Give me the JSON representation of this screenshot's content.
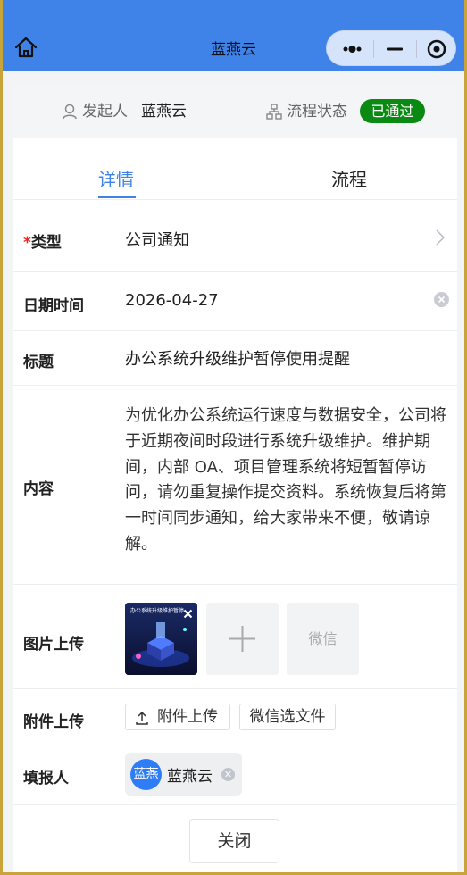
{
  "header": {
    "title": "蓝燕云",
    "home_icon": "home-icon",
    "capsule": {
      "more_icon": "more-dots-icon",
      "minimize_icon": "minimize-icon",
      "close_icon": "target-close-icon"
    }
  },
  "info": {
    "initiator_label": "发起人",
    "initiator_value": "蓝燕云",
    "status_label": "流程状态",
    "status_value": "已通过",
    "status_color": "#0b8a13"
  },
  "tabs": [
    {
      "label": "详情",
      "active": true
    },
    {
      "label": "流程",
      "active": false
    }
  ],
  "form": {
    "type": {
      "required_mark": "*",
      "label": "类型",
      "value": "公司通知"
    },
    "datetime": {
      "label": "日期时间",
      "value": "2026-04-27"
    },
    "title": {
      "label": "标题",
      "value": "办公系统升级维护暂停使用提醒"
    },
    "content": {
      "label": "内容",
      "value": "为优化办公系统运行速度与数据安全，公司将于近期夜间时段进行系统升级维护。维护期间，内部 OA、项目管理系统将短暂暂停访问，请勿重复操作提交资料。系统恢复后将第一时间同步通知，给大家带来不便，敬请谅解。"
    },
    "images": {
      "label": "图片上传",
      "thumbnail_caption": "办公系统升级维护暂停",
      "wechat_label": "微信"
    },
    "attachments": {
      "label": "附件上传",
      "upload_label": "附件上传",
      "wechat_file_label": "微信选文件"
    },
    "reporter": {
      "label": "填报人",
      "avatar_text": "蓝燕",
      "name": "蓝燕云"
    }
  },
  "footer": {
    "close_label": "关闭"
  },
  "colors": {
    "accent": "#3f83e9",
    "header_bg": "#3f83e9",
    "required": "#e22222"
  }
}
